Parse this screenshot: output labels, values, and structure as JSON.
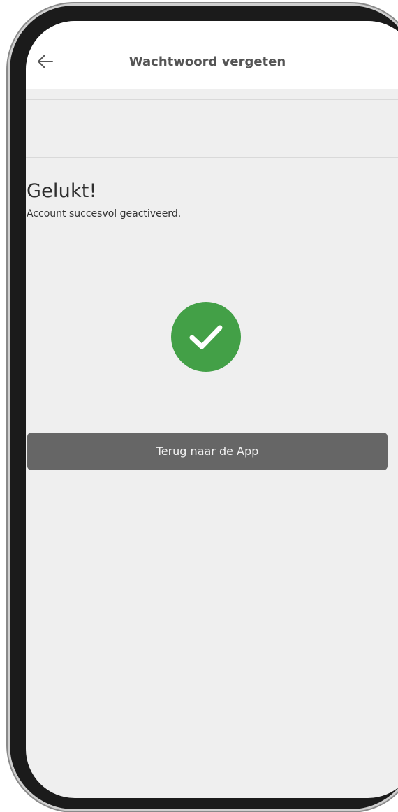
{
  "header": {
    "title": "Wachtwoord vergeten",
    "back_icon": "arrow-left-icon"
  },
  "message": {
    "title": "Gelukt!",
    "subtitle": "Account succesvol geactiveerd."
  },
  "status_icon": {
    "name": "check-circle-icon",
    "color": "#43a047"
  },
  "actions": {
    "return_label": "Terug naar de App"
  },
  "colors": {
    "background": "#efefef",
    "header_background": "#ffffff",
    "button_background": "#666666",
    "success_green": "#43a047"
  }
}
